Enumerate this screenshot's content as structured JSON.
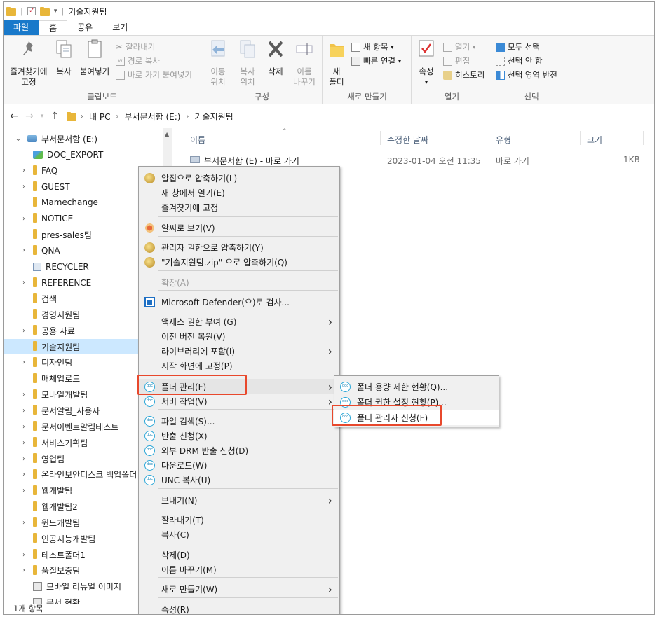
{
  "window": {
    "title": "기술지원팀"
  },
  "ribbon_tabs": [
    "파일",
    "홈",
    "공유",
    "보기"
  ],
  "ribbon": {
    "clipboard": {
      "label": "클립보드",
      "pin_label": "즐겨찾기에 고정",
      "copy_label": "복사",
      "paste_label": "붙여넣기",
      "cut_label": "잘라내기",
      "copy_path_label": "경로 복사",
      "paste_shortcut_label": "바로 가기 붙여넣기"
    },
    "organize": {
      "label": "구성",
      "move_label": "이동\n위치",
      "copy_to_label": "복사\n위치",
      "delete_label": "삭제",
      "rename_label": "이름\n바꾸기"
    },
    "new": {
      "label": "새로 만들기",
      "new_folder_label": "새\n폴더",
      "new_item_label": "새 항목",
      "easy_access_label": "빠른 연결"
    },
    "open": {
      "label": "열기",
      "properties_label": "속성",
      "open_label": "열기",
      "edit_label": "편집",
      "history_label": "히스토리"
    },
    "select": {
      "label": "선택",
      "select_all_label": "모두 선택",
      "select_none_label": "선택 안 함",
      "invert_label": "선택 영역 반전"
    }
  },
  "address": {
    "crumbs": [
      "내 PC",
      "부서문서함 (E:)",
      "기술지원팀"
    ]
  },
  "nav_tree": [
    {
      "label": "부서문서함 (E:)",
      "expand": "v",
      "icon": "drive-icon"
    },
    {
      "label": "DOC_EXPORT",
      "expand": "",
      "icon": "special-folder-icon"
    },
    {
      "label": "FAQ",
      "expand": ">",
      "icon": "folder-icon"
    },
    {
      "label": "GUEST",
      "expand": ">",
      "icon": "folder-icon"
    },
    {
      "label": "Mamechange",
      "expand": "",
      "icon": "folder-icon"
    },
    {
      "label": "NOTICE",
      "expand": ">",
      "icon": "folder-icon"
    },
    {
      "label": "pres-sales팀",
      "expand": "",
      "icon": "folder-icon"
    },
    {
      "label": "QNA",
      "expand": ">",
      "icon": "folder-icon"
    },
    {
      "label": "RECYCLER",
      "expand": "",
      "icon": "recycler-icon"
    },
    {
      "label": "REFERENCE",
      "expand": ">",
      "icon": "folder-icon"
    },
    {
      "label": "검색",
      "expand": "",
      "icon": "folder-icon"
    },
    {
      "label": "경영지원팀",
      "expand": "",
      "icon": "folder-icon"
    },
    {
      "label": "공용 자료",
      "expand": ">",
      "icon": "folder-icon"
    },
    {
      "label": "기술지원팀",
      "expand": "",
      "icon": "folder-icon"
    },
    {
      "label": "디자인팀",
      "expand": ">",
      "icon": "folder-icon"
    },
    {
      "label": "매체업로드",
      "expand": "",
      "icon": "folder-icon"
    },
    {
      "label": "모바일개발팀",
      "expand": ">",
      "icon": "folder-icon"
    },
    {
      "label": "문서알림_사용자",
      "expand": ">",
      "icon": "folder-icon"
    },
    {
      "label": "문서이벤트알림테스트",
      "expand": ">",
      "icon": "folder-icon"
    },
    {
      "label": "서비스기획팀",
      "expand": ">",
      "icon": "folder-icon"
    },
    {
      "label": "영업팀",
      "expand": ">",
      "icon": "folder-icon"
    },
    {
      "label": "온라인보안디스크 백업폴더",
      "expand": ">",
      "icon": "folder-icon"
    },
    {
      "label": "웹개발팀",
      "expand": ">",
      "icon": "folder-icon"
    },
    {
      "label": "웹개발팀2",
      "expand": "",
      "icon": "folder-icon"
    },
    {
      "label": "윈도개발팀",
      "expand": ">",
      "icon": "folder-icon"
    },
    {
      "label": "인공지능개발팀",
      "expand": "",
      "icon": "folder-icon"
    },
    {
      "label": "테스트폴더1",
      "expand": ">",
      "icon": "folder-icon"
    },
    {
      "label": "품질보증팀",
      "expand": ">",
      "icon": "folder-icon"
    },
    {
      "label": "모바일 리뉴얼 이미지",
      "expand": "",
      "icon": "zip-folder-icon"
    },
    {
      "label": "문서 현황",
      "expand": "",
      "icon": "zip-folder-icon"
    }
  ],
  "file_list": {
    "columns": [
      "이름",
      "수정한 날짜",
      "유형",
      "크기"
    ],
    "rows": [
      {
        "name": "부서문서함 (E) - 바로 가기",
        "date": "2023-01-04 오전 11:35",
        "type": "바로 가기",
        "size": "1KB"
      }
    ]
  },
  "status_bar": "1개 항목",
  "context_menu": {
    "items": [
      {
        "label": "알집으로 압축하기(L)",
        "icon": "alzip-icon",
        "arrow": false
      },
      {
        "label": "새 창에서 열기(E)",
        "icon": "",
        "arrow": false
      },
      {
        "label": "즐겨찾기에 고정",
        "icon": "",
        "arrow": false
      },
      {
        "label": "알씨로 보기(V)",
        "icon": "alsee-icon",
        "arrow": false
      },
      {
        "label": "관리자 권한으로 압축하기(Y)",
        "icon": "alzip-admin-icon",
        "arrow": false
      },
      {
        "label": "\"기술지원팀.zip\" 으로 압축하기(Q)",
        "icon": "alzip-icon",
        "arrow": false
      },
      {
        "label": "확장(A)",
        "icon": "",
        "arrow": false
      },
      {
        "label": "Microsoft Defender(으)로 검사...",
        "icon": "defender-icon",
        "arrow": false
      },
      {
        "label": "액세스 권한 부여 (G)",
        "icon": "",
        "arrow": true
      },
      {
        "label": "이전 버전 복원(V)",
        "icon": "",
        "arrow": false
      },
      {
        "label": "라이브러리에 포함(I)",
        "icon": "",
        "arrow": true
      },
      {
        "label": "시작 화면에 고정(P)",
        "icon": "",
        "arrow": false
      },
      {
        "label": "폴더 관리(F)",
        "icon": "doc-icon",
        "arrow": true
      },
      {
        "label": "서버 작업(V)",
        "icon": "doc-icon",
        "arrow": true
      },
      {
        "label": "파일 검색(S)...",
        "icon": "doc-icon",
        "arrow": false
      },
      {
        "label": "반출 신청(X)",
        "icon": "doc-icon",
        "arrow": false
      },
      {
        "label": "외부 DRM 반출 신청(D)",
        "icon": "doc-icon",
        "arrow": false
      },
      {
        "label": "다운로드(W)",
        "icon": "doc-icon",
        "arrow": false
      },
      {
        "label": "UNC 복사(U)",
        "icon": "doc-icon",
        "arrow": false
      },
      {
        "label": "보내기(N)",
        "icon": "",
        "arrow": true
      },
      {
        "label": "잘라내기(T)",
        "icon": "",
        "arrow": false
      },
      {
        "label": "복사(C)",
        "icon": "",
        "arrow": false
      },
      {
        "label": "삭제(D)",
        "icon": "",
        "arrow": false
      },
      {
        "label": "이름 바꾸기(M)",
        "icon": "",
        "arrow": false
      },
      {
        "label": "새로 만들기(W)",
        "icon": "",
        "arrow": true
      },
      {
        "label": "속성(R)",
        "icon": "",
        "arrow": false
      }
    ]
  },
  "submenu": {
    "items": [
      {
        "label": "폴더 용량 제한 현황(Q)...",
        "icon": "doc-icon"
      },
      {
        "label": "폴더 권한 설정 현황(P)...",
        "icon": "doc-icon"
      },
      {
        "label": "폴더 관리자 신청(F)",
        "icon": "doc-icon"
      }
    ]
  },
  "icon_text": "doc",
  "colors": {
    "accent": "#1979ca",
    "selection": "#cce8ff",
    "highlight_box": "#e8482c"
  }
}
